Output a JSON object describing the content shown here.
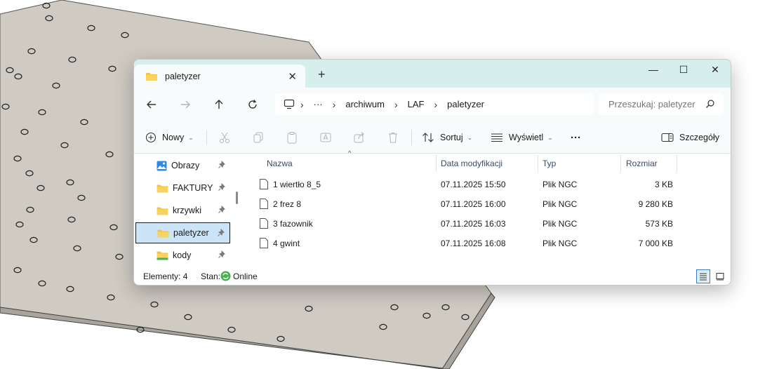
{
  "window": {
    "tab_title": "paletyzer",
    "new_tab_symbol": "+",
    "close_symbol": "✕",
    "minimize_symbol": "—",
    "maximize_symbol": "☐",
    "window_close_symbol": "✕"
  },
  "address": {
    "ellipsis": "···",
    "breadcrumb": [
      "archiwum",
      "LAF",
      "paletyzer"
    ],
    "search_placeholder": "Przeszukaj: paletyzer"
  },
  "toolbar": {
    "new_label": "Nowy",
    "sort_label": "Sortuj",
    "view_label": "Wyświetl",
    "more_label": "···",
    "details_label": "Szczegóły"
  },
  "sidebar": {
    "items": [
      {
        "label": "Obrazy",
        "icon": "pictures-icon"
      },
      {
        "label": "FAKTURY",
        "icon": "folder-icon"
      },
      {
        "label": "krzywki",
        "icon": "folder-icon"
      },
      {
        "label": "paletyzer",
        "icon": "folder-icon",
        "selected": true
      },
      {
        "label": "kody",
        "icon": "folder-green-icon"
      }
    ]
  },
  "columns": {
    "name": "Nazwa",
    "modified": "Data modyfikacji",
    "type": "Typ",
    "size": "Rozmiar"
  },
  "files": [
    {
      "name": "1 wiertło 8_5",
      "modified": "07.11.2025 15:50",
      "type": "Plik NGC",
      "size": "3 KB"
    },
    {
      "name": "2 frez 8",
      "modified": "07.11.2025 16:00",
      "type": "Plik NGC",
      "size": "9 280 KB"
    },
    {
      "name": "3 fazownik",
      "modified": "07.11.2025 16:03",
      "type": "Plik NGC",
      "size": "573 KB"
    },
    {
      "name": "4 gwint",
      "modified": "07.11.2025 16:08",
      "type": "Plik NGC",
      "size": "7 000 KB"
    }
  ],
  "status": {
    "elements": "Elementy: 4",
    "state_label": "Stan:",
    "state_value": "Online"
  },
  "colors": {
    "titlebar": "#d6efed",
    "selection": "#cce4f7",
    "folder": "#f5c242",
    "online": "#4caf50"
  }
}
